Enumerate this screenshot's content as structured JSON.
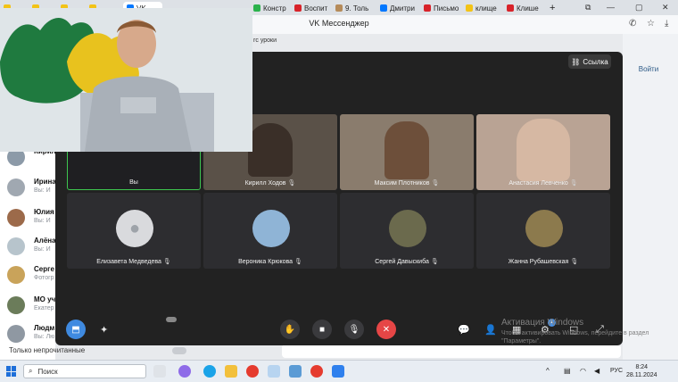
{
  "browser": {
    "tabs": [
      {
        "label": "",
        "color": "#f3c316"
      },
      {
        "label": "",
        "color": "#f3c316"
      },
      {
        "label": "",
        "color": "#f3c316"
      },
      {
        "label": "",
        "color": "#f3c316"
      },
      {
        "label": "VK",
        "color": "#0077ff"
      },
      {
        "label": "Констр",
        "color": "#2bb24c"
      },
      {
        "label": "Воспит",
        "color": "#d8232a"
      },
      {
        "label": "9. Толь",
        "color": "#b58b5a"
      },
      {
        "label": "Дмитри",
        "color": "#0077ff"
      },
      {
        "label": "Письмо",
        "color": "#d8232a"
      },
      {
        "label": "клище",
        "color": "#f3c316"
      },
      {
        "label": "Клише",
        "color": "#d8232a"
      }
    ],
    "new_tab_symbol": "+",
    "window_title": "VK Мессенджер"
  },
  "vk": {
    "top_label": "гс уроки",
    "right_button": "Войти",
    "contacts": [
      {
        "name": "Кирил",
        "sub": "",
        "color": "#8c9aa8"
      },
      {
        "name": "Ирина",
        "sub": "Вы: И",
        "color": "#a0a8b1"
      },
      {
        "name": "Юлия",
        "sub": "Вы: И",
        "color": "#9c6a4a"
      },
      {
        "name": "Алёна",
        "sub": "Вы: И",
        "color": "#b7c4cc"
      },
      {
        "name": "Серге",
        "sub": "Фотогр",
        "color": "#c9a35a"
      },
      {
        "name": "МО уч",
        "sub": "Екатер",
        "color": "#6b7c5a"
      },
      {
        "name": "Людм",
        "sub": "Вы: Лю",
        "color": "#8f98a2"
      }
    ],
    "unread_label": "Только непрочитанные"
  },
  "call": {
    "link_button": "Ссылка",
    "self_label": "Вы",
    "participants": [
      {
        "name": "Кирилл Ходов",
        "bg": "#5a5148",
        "avatar": false
      },
      {
        "name": "Максим Плотников",
        "bg": "#8a7c6d",
        "avatar": false
      },
      {
        "name": "Анастасия Левченко",
        "bg": "#b9a394",
        "avatar": false
      },
      {
        "name": "Елизавета Медведева",
        "bg": "#2d2d30",
        "avatar": true,
        "avatar_color": "#d9dadd"
      },
      {
        "name": "Вероника Крюкова",
        "bg": "#2d2d30",
        "avatar": true,
        "avatar_color": "#8fb4d6"
      },
      {
        "name": "Сергей Давыскиба",
        "bg": "#2d2d30",
        "avatar": true,
        "avatar_color": "#6b6a4d"
      },
      {
        "name": "Жанна Рубашевская",
        "bg": "#2d2d30",
        "avatar": true,
        "avatar_color": "#8c7a4d"
      }
    ],
    "hand_badge": "1",
    "colors": {
      "end_call": "#e64646",
      "share": "#3f8ae0"
    }
  },
  "watermark": {
    "title": "Активация Windows",
    "subtitle": "Чтобы активировать Windows, перейдите в раздел \"Параметры\"."
  },
  "taskbar": {
    "search_placeholder": "Поиск",
    "lang": "РУС",
    "time": "8:24",
    "date": "28.11.2024"
  }
}
